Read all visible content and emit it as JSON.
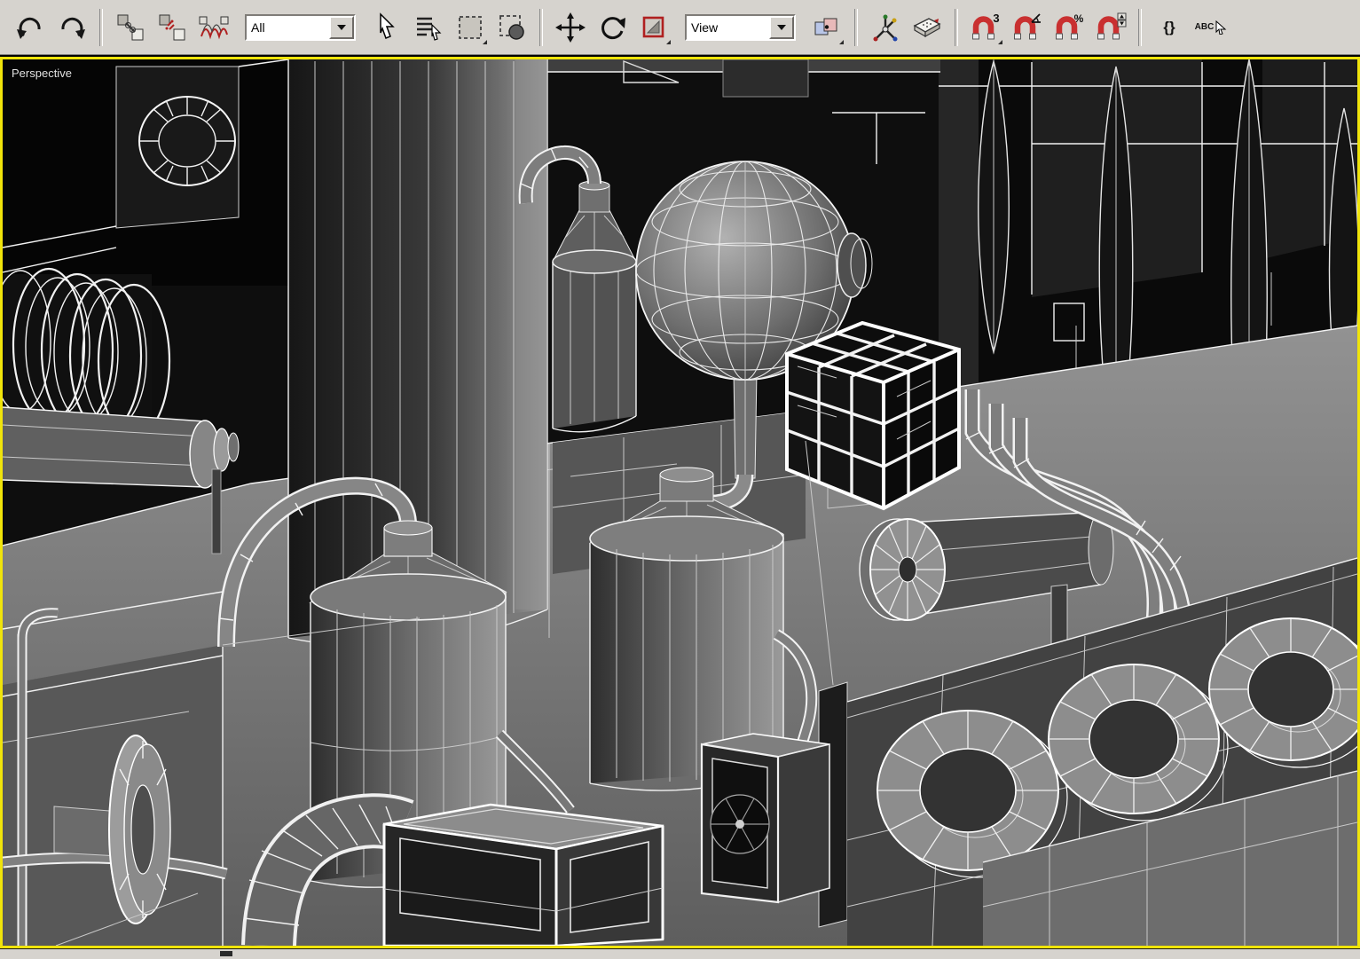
{
  "toolbar": {
    "selection_filter": "All",
    "reference_coordinate_system": "View",
    "snap_3d_label": "3",
    "percent_snap_label": "%",
    "edit_named_sets_label": "{}",
    "named_sets_label": "ABC"
  },
  "viewport": {
    "label": "Perspective",
    "active_border_color": "#f0e40a",
    "background_color": "#0e0e0e",
    "wireframe_color": "#ffffff",
    "objects": [
      "coil-spring",
      "horizontal-cylinder",
      "large-column",
      "small-cone-tank",
      "wireframe-sphere",
      "lattice-cube",
      "tank-left",
      "tank-center",
      "turbine-cylinder",
      "pipe-bundle",
      "torus-panel",
      "flange-disc",
      "bellows-elbow",
      "cage-box",
      "fan-box",
      "background-wall-right",
      "background-wall-left",
      "platform"
    ]
  },
  "colors": {
    "toolbar_bg": "#d6d3ce",
    "toolbar_border": "#808080",
    "magnet_red": "#c93030"
  }
}
